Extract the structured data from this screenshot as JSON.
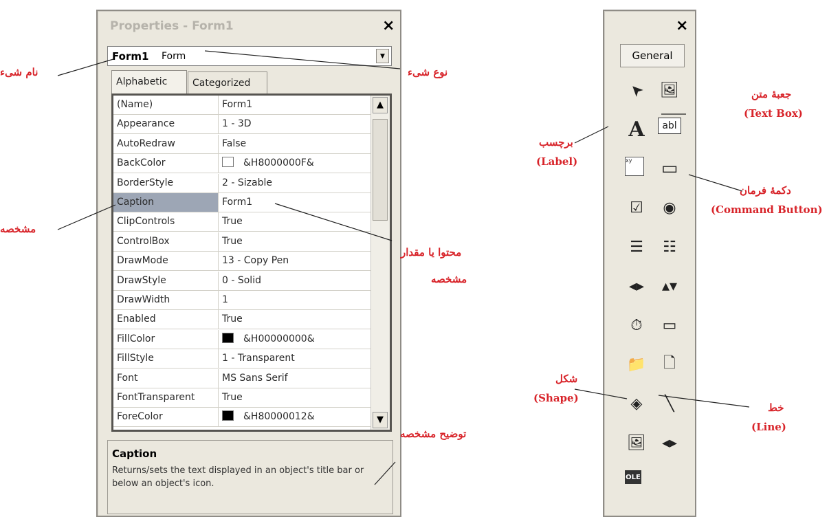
{
  "properties_window": {
    "title": "Properties - Form1",
    "close_label": "×",
    "object_combo": {
      "name": "Form1",
      "type": "Form",
      "arrow": "▼"
    },
    "tabs": [
      "Alphabetic",
      "Categorized"
    ],
    "rows": [
      {
        "name": "(Name)",
        "value": "Form1"
      },
      {
        "name": "Appearance",
        "value": "1 - 3D"
      },
      {
        "name": "AutoRedraw",
        "value": "False"
      },
      {
        "name": "BackColor",
        "value": "&H8000000F&",
        "swatch": "#ffffff"
      },
      {
        "name": "BorderStyle",
        "value": "2 - Sizable"
      },
      {
        "name": "Caption",
        "value": "Form1",
        "selected": true
      },
      {
        "name": "ClipControls",
        "value": "True"
      },
      {
        "name": "ControlBox",
        "value": "True"
      },
      {
        "name": "DrawMode",
        "value": "13 - Copy Pen"
      },
      {
        "name": "DrawStyle",
        "value": "0 - Solid"
      },
      {
        "name": "DrawWidth",
        "value": "1"
      },
      {
        "name": "Enabled",
        "value": "True"
      },
      {
        "name": "FillColor",
        "value": "&H00000000&",
        "swatch": "#000000"
      },
      {
        "name": "FillStyle",
        "value": "1 - Transparent"
      },
      {
        "name": "Font",
        "value": "MS Sans Serif"
      },
      {
        "name": "FontTransparent",
        "value": "True"
      },
      {
        "name": "ForeColor",
        "value": "&H80000012&",
        "swatch": "#000000"
      }
    ],
    "scroll_up": "▲",
    "scroll_down": "▼",
    "description": {
      "title": "Caption",
      "text": "Returns/sets the text displayed in an object's title bar or below an object's icon."
    }
  },
  "toolbox": {
    "close_label": "×",
    "tab_label": "General",
    "tools": [
      {
        "icon": "pointer-icon",
        "glyph": "➤"
      },
      {
        "icon": "picturebox-icon",
        "glyph": "🖼"
      },
      {
        "icon": "label-icon",
        "glyph": "A"
      },
      {
        "icon": "textbox-icon",
        "glyph": "abl"
      },
      {
        "icon": "frame-icon",
        "glyph": "xy"
      },
      {
        "icon": "command-button-icon",
        "glyph": "▭"
      },
      {
        "icon": "checkbox-icon",
        "glyph": "☑"
      },
      {
        "icon": "option-button-icon",
        "glyph": "◉"
      },
      {
        "icon": "combobox-icon",
        "glyph": "☰"
      },
      {
        "icon": "listbox-icon",
        "glyph": "☷"
      },
      {
        "icon": "hscrollbar-icon",
        "glyph": "◂▸"
      },
      {
        "icon": "vscrollbar-icon",
        "glyph": "▴▾"
      },
      {
        "icon": "timer-icon",
        "glyph": "⏱"
      },
      {
        "icon": "drivelistbox-icon",
        "glyph": "▭"
      },
      {
        "icon": "dirlistbox-icon",
        "glyph": "📁"
      },
      {
        "icon": "filelistbox-icon",
        "glyph": "🗋"
      },
      {
        "icon": "shape-icon",
        "glyph": "◈"
      },
      {
        "icon": "line-icon",
        "glyph": "╲"
      },
      {
        "icon": "image-icon",
        "glyph": "🖼"
      },
      {
        "icon": "data-icon",
        "glyph": "◂▸"
      },
      {
        "icon": "ole-icon",
        "glyph": "OLE"
      }
    ]
  },
  "annotations": {
    "object_name": "نام شیء",
    "object_type": "نوع شیء",
    "property": "مشخصه",
    "property_value_1": "محتوا یا مقدار",
    "property_value_2": "مشخصه",
    "property_description": "توضیح مشخصه",
    "textbox_fa": "جعبهٔ متن",
    "textbox_en": "(Text Box)",
    "label_fa": "برچسب",
    "label_en": "(Label)",
    "command_fa": "دکمهٔ فرمان",
    "command_en": "(Command Button)",
    "shape_fa": "شکل",
    "shape_en": "(Shape)",
    "line_fa": "خط",
    "line_en": "(Line)"
  },
  "colors": {
    "annotation": "#d8242a",
    "panel": "#ebe8de",
    "selected_row": "#9da6b5"
  }
}
